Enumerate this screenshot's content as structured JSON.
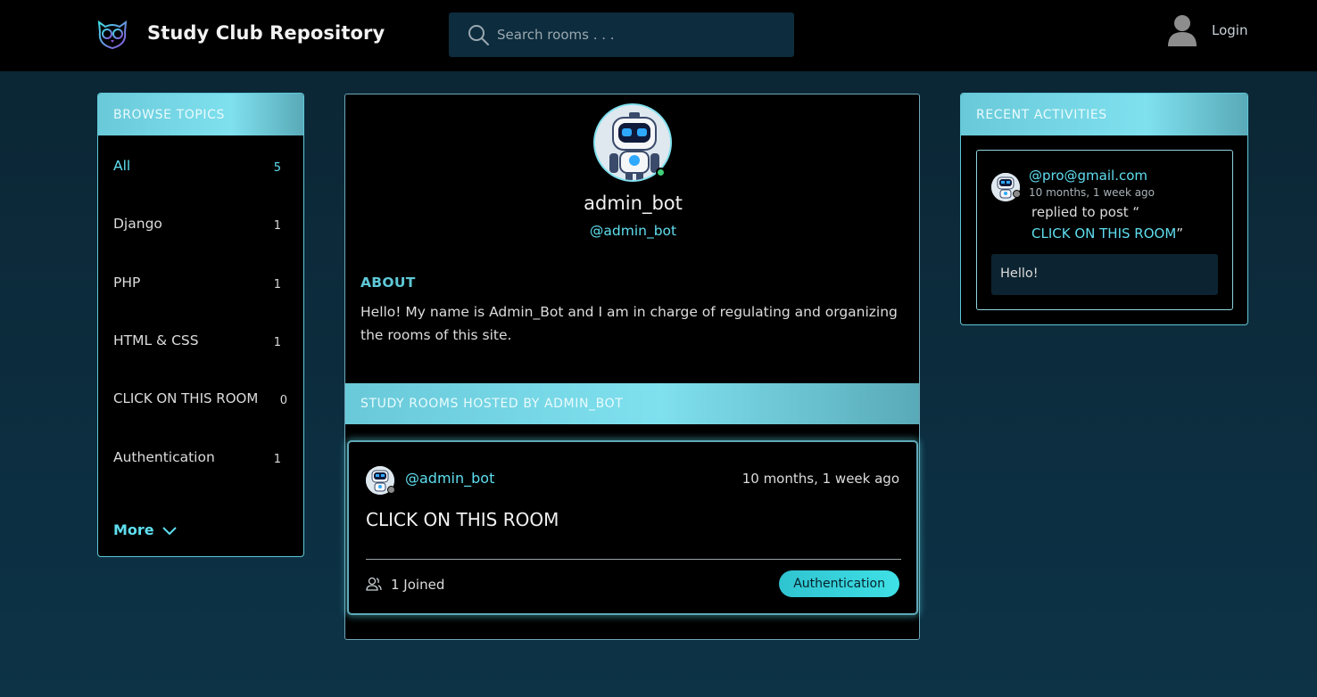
{
  "header": {
    "brand": "Study Club Repository",
    "search_placeholder": "Search rooms . . .",
    "login_label": "Login"
  },
  "topics": {
    "heading": "BROWSE TOPICS",
    "items": [
      {
        "name": "All",
        "count": "5"
      },
      {
        "name": "Django",
        "count": "1"
      },
      {
        "name": "PHP",
        "count": "1"
      },
      {
        "name": "HTML & CSS",
        "count": "1"
      },
      {
        "name": "CLICK ON THIS ROOM",
        "count": "0"
      },
      {
        "name": "Authentication",
        "count": "1"
      }
    ],
    "more_label": "More"
  },
  "profile": {
    "name": "admin_bot",
    "handle": "@admin_bot",
    "about_heading": "ABOUT",
    "about_text": "Hello! My name is Admin_Bot and I am in charge of regulating and organizing the rooms of this site."
  },
  "rooms": {
    "heading": "STUDY ROOMS HOSTED BY ADMIN_BOT",
    "items": [
      {
        "host": "@admin_bot",
        "time": "10 months, 1 week ago",
        "title": "CLICK ON THIS ROOM",
        "joined": "1 Joined",
        "topic": "Authentication"
      }
    ]
  },
  "activities": {
    "heading": "RECENT ACTIVITIES",
    "items": [
      {
        "user": "@pro@gmail.com",
        "time": "10 months, 1 week ago",
        "verb": "replied to post “",
        "room": "CLICK ON THIS ROOM",
        "close_quote": "”",
        "message": "Hello!"
      }
    ]
  },
  "colors": {
    "accent": "#5fdff0",
    "panel_header": "#7fe0ee",
    "online": "#3fd07a",
    "background": "#0d3347"
  }
}
